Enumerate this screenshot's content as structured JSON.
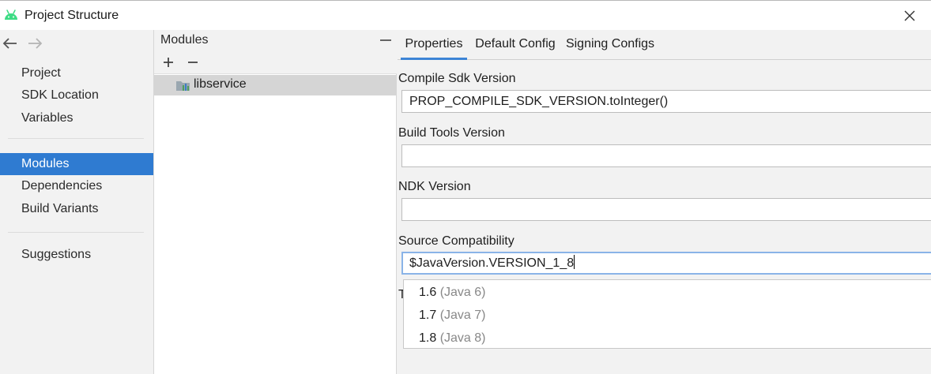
{
  "window": {
    "title": "Project Structure",
    "icon": "android-icon",
    "accent_color": "#3ddc84"
  },
  "nav": {
    "items": [
      {
        "label": "Project"
      },
      {
        "label": "SDK Location"
      },
      {
        "label": "Variables"
      },
      {
        "label": "Modules",
        "selected": true
      },
      {
        "label": "Dependencies"
      },
      {
        "label": "Build Variants"
      },
      {
        "label": "Suggestions"
      }
    ],
    "selected_color": "#2f7bd1"
  },
  "modules": {
    "title": "Modules",
    "items": [
      {
        "label": "libservice"
      }
    ]
  },
  "tabs": [
    {
      "label": "Properties",
      "active": true
    },
    {
      "label": "Default Config"
    },
    {
      "label": "Signing Configs"
    }
  ],
  "properties": {
    "compile_sdk": {
      "label": "Compile Sdk Version",
      "value": "PROP_COMPILE_SDK_VERSION.toInteger()"
    },
    "build_tools": {
      "label": "Build Tools Version",
      "value": ""
    },
    "ndk": {
      "label": "NDK Version",
      "value": ""
    },
    "source_compat": {
      "label": "Source Compatibility",
      "value": "$JavaVersion.VERSION_1_8"
    },
    "target_compat_stub": "T"
  },
  "dropdown": {
    "options": [
      {
        "value": "1.6",
        "hint": "(Java 6)"
      },
      {
        "value": "1.7",
        "hint": "(Java 7)"
      },
      {
        "value": "1.8",
        "hint": "(Java 8)"
      }
    ]
  }
}
